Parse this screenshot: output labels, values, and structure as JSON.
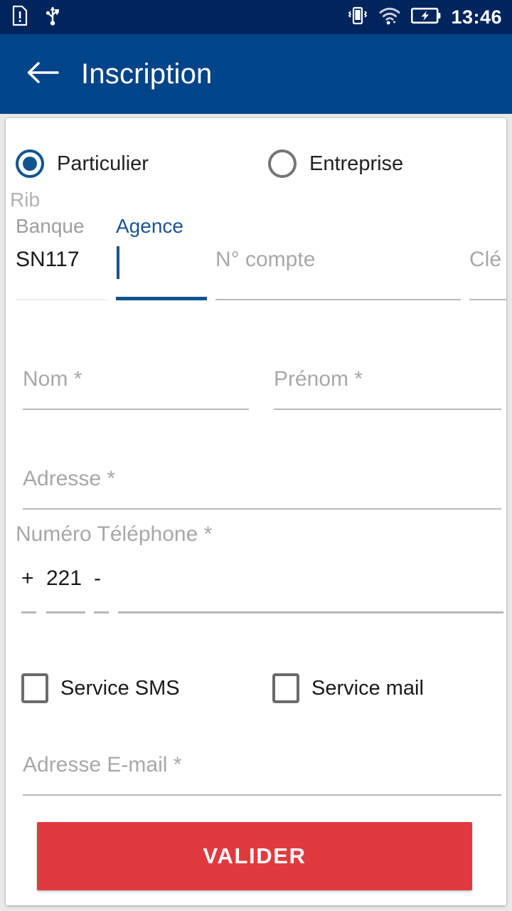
{
  "statusbar": {
    "time": "13:46",
    "icons": [
      {
        "name": "sim-card-alert-icon"
      },
      {
        "name": "usb-icon"
      },
      {
        "name": "vibrate-icon"
      },
      {
        "name": "wifi-icon"
      },
      {
        "name": "battery-charging-icon"
      }
    ]
  },
  "appbar": {
    "back_icon": "arrow-left-icon",
    "title": "Inscription",
    "background": "#004489"
  },
  "form": {
    "account_type": {
      "options": [
        {
          "label": "Particulier",
          "selected": true
        },
        {
          "label": "Entreprise",
          "selected": false
        }
      ]
    },
    "rib": {
      "caption": "Rib",
      "fields": [
        {
          "label": "Banque",
          "value": "SN117",
          "placeholder": "",
          "focused": false
        },
        {
          "label": "Agence",
          "value": "",
          "placeholder": "",
          "focused": true
        },
        {
          "label": "",
          "value": "",
          "placeholder": "N° compte",
          "focused": false
        },
        {
          "label": "",
          "value": "",
          "placeholder": "Clé",
          "focused": false
        }
      ]
    },
    "nom": {
      "placeholder": "Nom *",
      "value": ""
    },
    "prenom": {
      "placeholder": "Prénom *",
      "value": ""
    },
    "adresse": {
      "placeholder": "Adresse *",
      "value": ""
    },
    "phone": {
      "label": "Numéro Téléphone *",
      "plus": "+",
      "country_code": "221",
      "separator": "-",
      "number": ""
    },
    "services": [
      {
        "label": "Service SMS",
        "checked": false
      },
      {
        "label": "Service mail",
        "checked": false
      }
    ],
    "email": {
      "placeholder": "Adresse E-mail *",
      "value": ""
    },
    "submit": {
      "label": "VALIDER",
      "color": "#e13a3e"
    }
  }
}
